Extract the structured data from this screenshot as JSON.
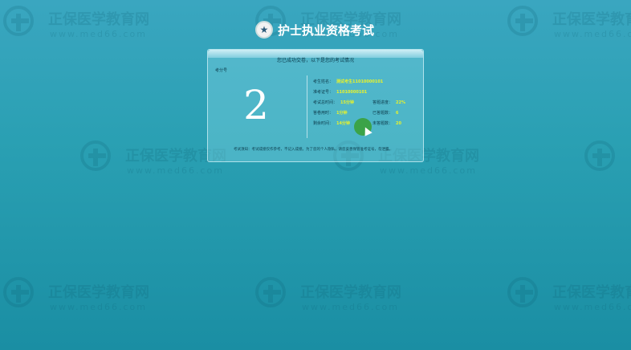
{
  "watermark": {
    "brand_cn": "正保医学教育网",
    "url": "www.med66.com"
  },
  "header": {
    "title": "护士执业资格考试"
  },
  "panel": {
    "message": "您已成功交卷，以下是您的考试情况",
    "score_label": "考分号",
    "score": "2",
    "fields": {
      "name_label": "考生姓名：",
      "name_value": "测试考生11010000101",
      "ticket_label": "准考证号：",
      "ticket_value": "11010000101",
      "total_time_label": "考试总时间：",
      "total_time_value": "15分钟",
      "progress_label": "答题进度：",
      "progress_value": "22%",
      "used_time_label": "答卷用时：",
      "used_time_value": "1分钟",
      "answered_label": "已答题数：",
      "answered_value": "6",
      "remaining_time_label": "剩余时间：",
      "remaining_time_value": "14分钟",
      "unanswered_label": "未答题数：",
      "unanswered_value": "20"
    },
    "notice": "考试须知：考试成绩仅作参考，不记入成绩。为了您的个人隐私，请您妥善保管准考证号，勿泄露。"
  },
  "colors": {
    "background": "#2aa0b3",
    "value_highlight": "#e8f22b",
    "cursor_dot": "#3aa13a"
  }
}
